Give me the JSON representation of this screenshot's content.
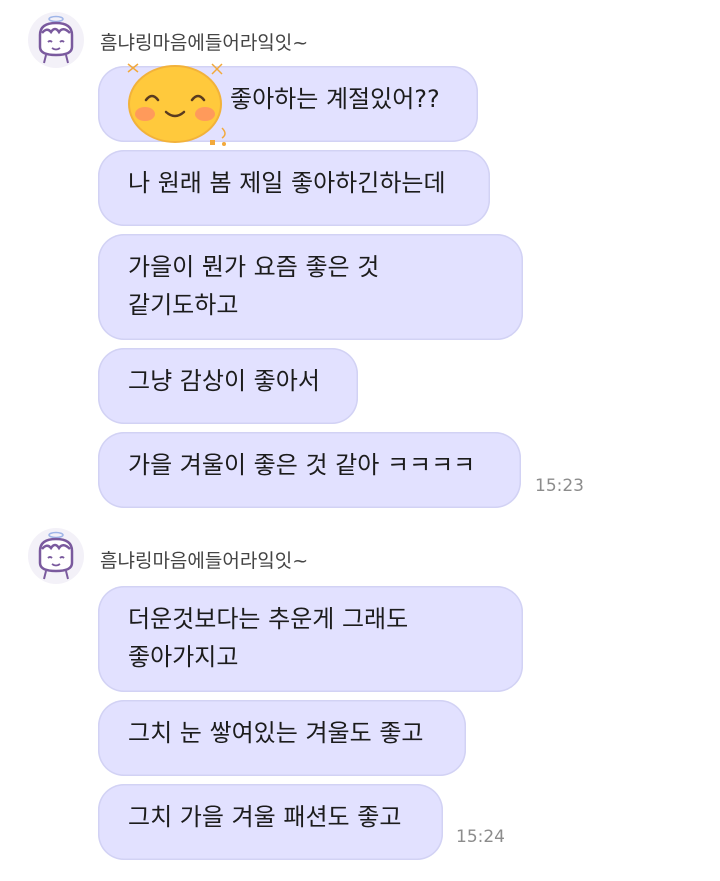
{
  "groups": [
    {
      "sender": "흠냐링마음에들어라잌잇~",
      "messages": [
        {
          "lines": [
            "좋아하는 계절있어??"
          ],
          "has_emoticon": true
        },
        {
          "lines": [
            "나 원래 봄 제일 좋아하긴하는데"
          ]
        },
        {
          "lines": [
            "가을이 뭔가 요즘 좋은 것",
            "같기도하고"
          ]
        },
        {
          "lines": [
            "그냥 감상이 좋아서"
          ]
        },
        {
          "lines": [
            "가을 겨울이 좋은 것 같아 ㅋㅋㅋㅋ"
          ]
        }
      ],
      "time": "15:23"
    },
    {
      "sender": "흠냐링마음에들어라잌잇~",
      "messages": [
        {
          "lines": [
            "더운것보다는 추운게 그래도",
            "좋아가지고"
          ]
        },
        {
          "lines": [
            "그치 눈 쌓여있는 겨울도 좋고"
          ]
        },
        {
          "lines": [
            "그치 가을 겨울 패션도 좋고"
          ]
        }
      ],
      "time": "15:24"
    }
  ],
  "colors": {
    "bubble": "#e2e1ff",
    "bubble_border": "#d2d2f4",
    "avatar_line": "#7a5a9e",
    "emoticon_face": "#ffc93c"
  },
  "icons": {
    "avatar": "cartoon-character-avatar-icon",
    "emoticon": "smiling-face-emoticon-icon"
  }
}
